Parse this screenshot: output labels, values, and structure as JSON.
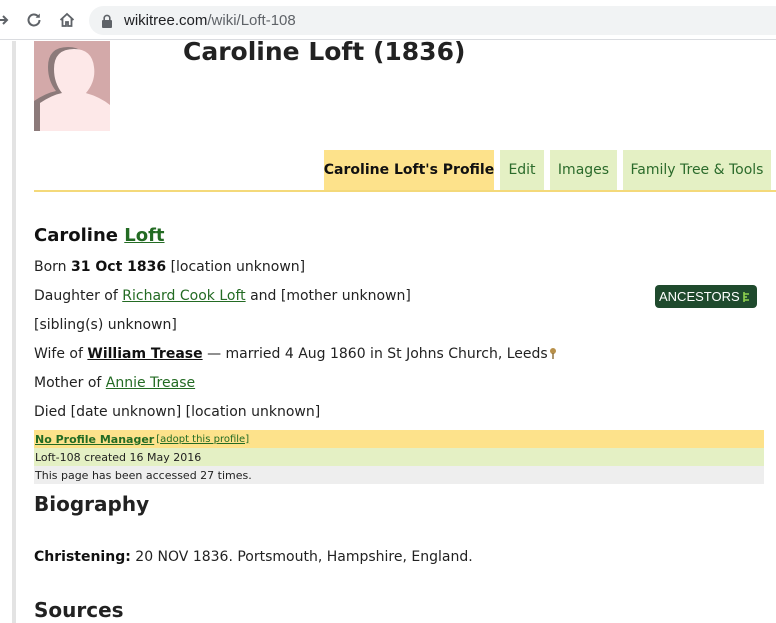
{
  "browser": {
    "url_host": "wikitree.com",
    "url_path": "/wiki/Loft-108"
  },
  "profile": {
    "title": "Caroline Loft (1836)",
    "tabs": [
      {
        "label": "Caroline Loft's Profile",
        "active": true
      },
      {
        "label": "Edit",
        "active": false
      },
      {
        "label": "Images",
        "active": false
      },
      {
        "label": "Family Tree & Tools",
        "active": false
      }
    ],
    "name": {
      "first": "Caroline",
      "last": "Loft"
    },
    "born": {
      "prefix": "Born",
      "date": "31 Oct 1836",
      "place": "[location unknown]"
    },
    "parents": {
      "prefix": "Daughter of",
      "father": "Richard Cook Loft",
      "joiner": "and",
      "mother": "[mother unknown]"
    },
    "siblings": "[sibling(s) unknown]",
    "spouse": {
      "prefix": "Wife of",
      "name": "William Trease",
      "detail": "— married 4 Aug 1860 in St Johns Church, Leeds"
    },
    "children": {
      "prefix": "Mother of",
      "name": "Annie Trease"
    },
    "died": "Died [date unknown] [location unknown]",
    "ancestors_label": "ANCESTORS",
    "manager": {
      "label": "No Profile Manager",
      "adopt": "[adopt this profile]"
    },
    "created": "Loft-108 created 16 May 2016",
    "accessed": "This page has been accessed 27 times."
  },
  "biography": {
    "heading": "Biography",
    "christening_label": "Christening:",
    "christening_text": "20 NOV 1836. Portsmouth, Hampshire, England."
  },
  "sources": {
    "heading": "Sources"
  },
  "colors": {
    "accent_green": "#236b23",
    "tab_yellow": "#fde28b",
    "tab_green": "#e4f0c4",
    "badge": "#1f4a2d"
  }
}
